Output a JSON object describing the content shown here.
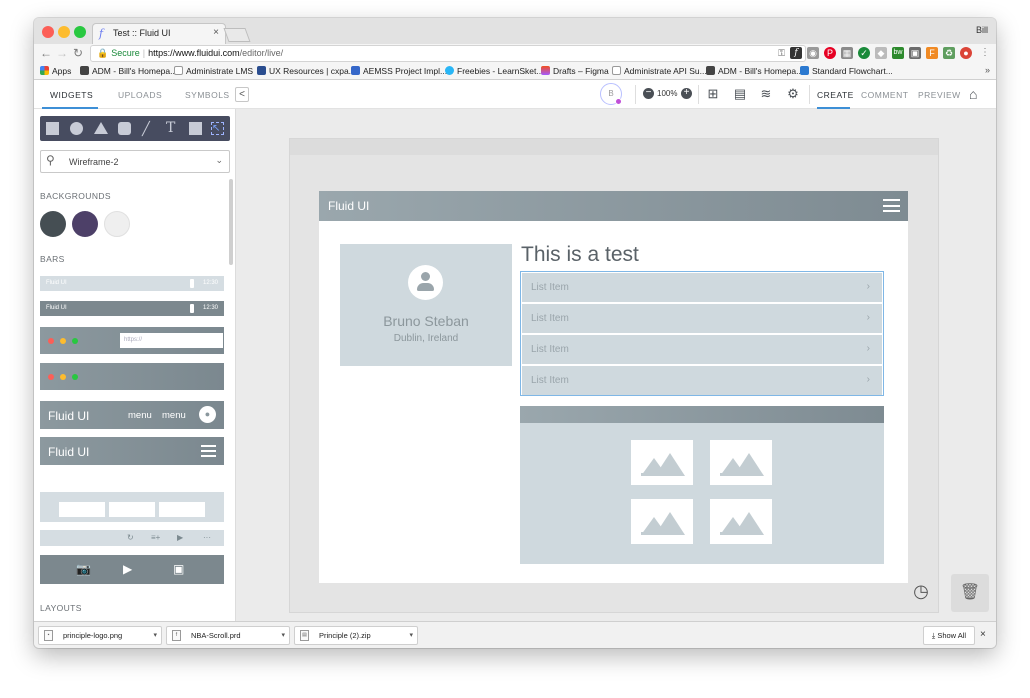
{
  "browser": {
    "tab_title": "Test :: Fluid UI",
    "tab_close": "×",
    "profile_name": "Bill",
    "secure_label": "Secure",
    "url_host": "https://www.fluidui.com",
    "url_path": "/editor/live/",
    "bookmarks": [
      "Apps",
      "ADM - Bill's Homepa...",
      "Administrate LMS",
      "UX Resources | cxpa...",
      "AEMSS Project Impl...",
      "Freebies - LearnSket...",
      "Drafts – Figma",
      "Administrate API Su...",
      "ADM - Bill's Homepa...",
      "Standard Flowchart..."
    ],
    "bookmarks_more": "»"
  },
  "toolbar": {
    "left_tabs": [
      "WIDGETS",
      "UPLOADS",
      "SYMBOLS"
    ],
    "collapse_glyph": "<",
    "avatar_letter": "B",
    "zoom_level": "100%",
    "right_tabs": [
      "CREATE",
      "COMMENT",
      "PREVIEW"
    ]
  },
  "sidebar": {
    "search_value": "Wireframe-2",
    "sections": {
      "backgrounds": "BACKGROUNDS",
      "bars": "BARS",
      "layouts": "LAYOUTS"
    },
    "background_swatches": [
      "#454e53",
      "#4d4068",
      "#efefef"
    ],
    "bar_samples": {
      "status_label": "Fluid UI",
      "status_time": "12:30",
      "url_placeholder": "https://",
      "app_title": "Fluid UI",
      "menu_items": [
        "menu",
        "menu"
      ]
    }
  },
  "canvas": {
    "app_title": "Fluid UI",
    "page_title": "This is a test",
    "profile": {
      "name": "Bruno Steban",
      "location": "Dublin, Ireland"
    },
    "list_items": [
      "List Item",
      "List Item",
      "List Item",
      "List Item"
    ],
    "list_chevron": "›"
  },
  "downloads": {
    "items": [
      "principle-logo.png",
      "NBA-Scroll.prd",
      "Principle (2).zip"
    ],
    "show_all": "Show All",
    "close": "×"
  }
}
